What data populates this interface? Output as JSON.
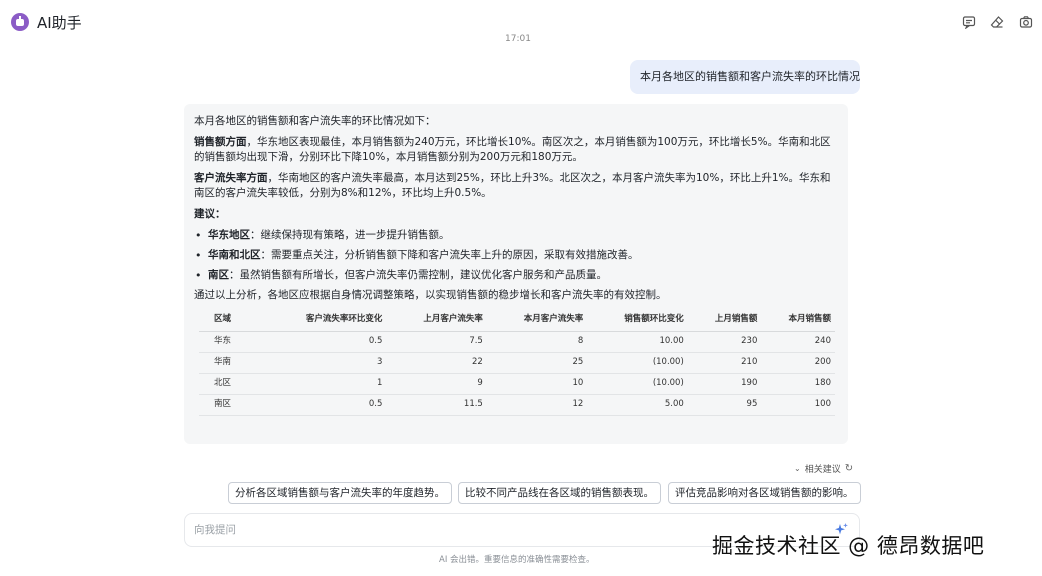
{
  "header": {
    "title": "AI助手",
    "icons": [
      "bot-logo-icon",
      "chat-icon",
      "eraser-icon",
      "camera-icon"
    ]
  },
  "conversation": {
    "timestamp": "17:01",
    "user_message": "本月各地区的销售额和客户流失率的环比情况",
    "answer": {
      "intro": "本月各地区的销售额和客户流失率的环比情况如下：",
      "sales_heading": "销售额方面",
      "sales_text": "，华东地区表现最佳，本月销售额为240万元，环比增长10%。南区次之，本月销售额为100万元，环比增长5%。华南和北区的销售额均出现下滑，分别环比下降10%，本月销售额分别为200万元和180万元。",
      "churn_heading": "客户流失率方面",
      "churn_text": "，华南地区的客户流失率最高，本月达到25%，环比上升3%。北区次之，本月客户流失率为10%，环比上升1%。华东和南区的客户流失率较低，分别为8%和12%，环比均上升0.5%。",
      "advice_heading": "建议：",
      "advice": [
        {
          "label": "华东地区",
          "text": "：继续保持现有策略，进一步提升销售额。"
        },
        {
          "label": "华南和北区",
          "text": "：需要重点关注，分析销售额下降和客户流失率上升的原因，采取有效措施改善。"
        },
        {
          "label": "南区",
          "text": "：虽然销售额有所增长，但客户流失率仍需控制，建议优化客户服务和产品质量。"
        }
      ],
      "conclusion": "通过以上分析，各地区应根据自身情况调整策略，以实现销售额的稳步增长和客户流失率的有效控制。",
      "table": {
        "headers": [
          "区域",
          "客户流失率环比变化",
          "上月客户流失率",
          "本月客户流失率",
          "销售额环比变化",
          "上月销售额",
          "本月销售额"
        ],
        "rows": [
          [
            "华东",
            "0.5",
            "7.5",
            "8",
            "10.00",
            "230",
            "240"
          ],
          [
            "华南",
            "3",
            "22",
            "25",
            "(10.00)",
            "210",
            "200"
          ],
          [
            "北区",
            "1",
            "9",
            "10",
            "(10.00)",
            "190",
            "180"
          ],
          [
            "南区",
            "0.5",
            "11.5",
            "12",
            "5.00",
            "95",
            "100"
          ]
        ]
      }
    }
  },
  "suggestions": {
    "label": "相关建议",
    "items": [
      "分析各区域销售额与客户流失率的年度趋势。",
      "比较不同产品线在各区域的销售额表现。",
      "评估竞品影响对各区域销售额的影响。"
    ]
  },
  "input": {
    "placeholder": "向我提问",
    "value": ""
  },
  "disclaimer": "AI 会出错。重要信息的准确性需要检查。",
  "watermark": "掘金技术社区 @ 德昂数据吧",
  "colors": {
    "user_bubble": "#e8eefb",
    "answer_bg": "#f5f6f7",
    "logo": "#8b5cc6"
  }
}
